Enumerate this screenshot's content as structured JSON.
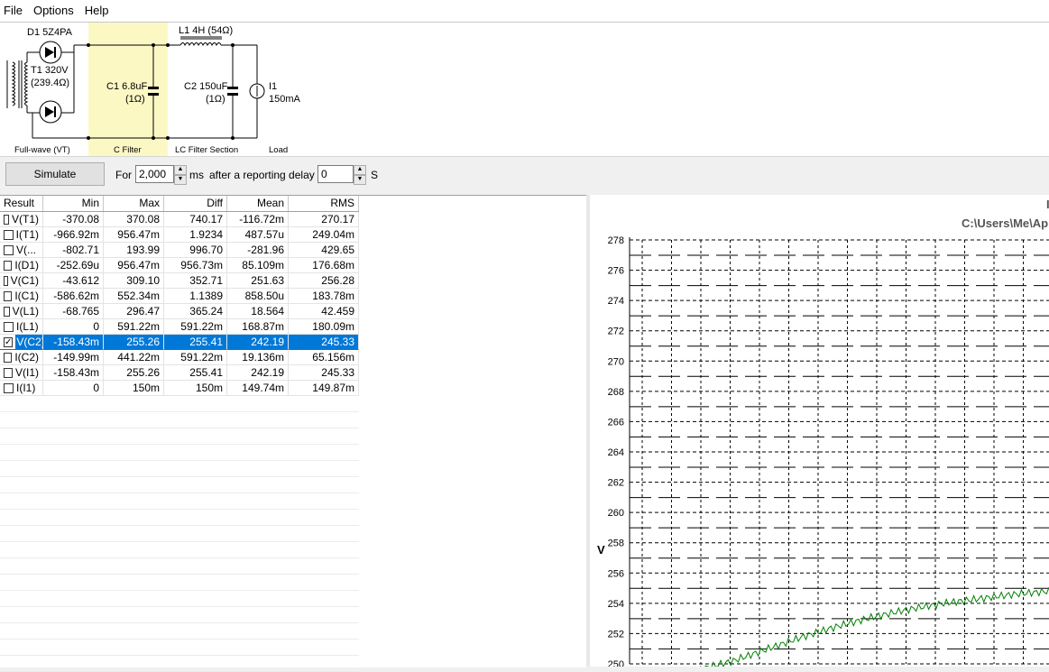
{
  "menu": [
    "File",
    "Options",
    "Help"
  ],
  "schematic": {
    "d1": "D1 5Z4PA",
    "t1a": "T1 320V",
    "t1b": "(239.4Ω)",
    "l1": "L1 4H (54Ω)",
    "c1a": "C1 6.8uF",
    "c1b": "(1Ω)",
    "c2a": "C2 150uF",
    "c2b": "(1Ω)",
    "i1a": "I1",
    "i1b": "150mA",
    "sec_fullwave": "Full-wave (VT)",
    "sec_cfilter": "C Filter",
    "sec_lc": "LC Filter Section",
    "sec_load": "Load"
  },
  "toolbar": {
    "simulate": "Simulate",
    "for_label": "For",
    "duration": "2,000",
    "ms_label": "ms",
    "after_label": "after a reporting delay of",
    "delay": "0",
    "s_label": "S"
  },
  "table": {
    "headers": [
      "Result",
      "Min",
      "Max",
      "Diff",
      "Mean",
      "RMS"
    ],
    "rows": [
      {
        "name": "V(T1)",
        "checked": false,
        "min": "-370.08",
        "max": "370.08",
        "diff": "740.17",
        "mean": "-116.72m",
        "rms": "270.17"
      },
      {
        "name": "I(T1)",
        "checked": false,
        "min": "-966.92m",
        "max": "956.47m",
        "diff": "1.9234",
        "mean": "487.57u",
        "rms": "249.04m"
      },
      {
        "name": "V(...",
        "checked": false,
        "min": "-802.71",
        "max": "193.99",
        "diff": "996.70",
        "mean": "-281.96",
        "rms": "429.65"
      },
      {
        "name": "I(D1)",
        "checked": false,
        "min": "-252.69u",
        "max": "956.47m",
        "diff": "956.73m",
        "mean": "85.109m",
        "rms": "176.68m"
      },
      {
        "name": "V(C1)",
        "checked": false,
        "min": "-43.612",
        "max": "309.10",
        "diff": "352.71",
        "mean": "251.63",
        "rms": "256.28"
      },
      {
        "name": "I(C1)",
        "checked": false,
        "min": "-586.62m",
        "max": "552.34m",
        "diff": "1.1389",
        "mean": "858.50u",
        "rms": "183.78m"
      },
      {
        "name": "V(L1)",
        "checked": false,
        "min": "-68.765",
        "max": "296.47",
        "diff": "365.24",
        "mean": "18.564",
        "rms": "42.459"
      },
      {
        "name": "I(L1)",
        "checked": false,
        "min": "0",
        "max": "591.22m",
        "diff": "591.22m",
        "mean": "168.87m",
        "rms": "180.09m"
      },
      {
        "name": "V(C2)",
        "checked": true,
        "min": "-158.43m",
        "max": "255.26",
        "diff": "255.41",
        "mean": "242.19",
        "rms": "245.33"
      },
      {
        "name": "I(C2)",
        "checked": false,
        "min": "-149.99m",
        "max": "441.22m",
        "diff": "591.22m",
        "mean": "19.136m",
        "rms": "65.156m"
      },
      {
        "name": "V(I1)",
        "checked": false,
        "min": "-158.43m",
        "max": "255.26",
        "diff": "255.41",
        "mean": "242.19",
        "rms": "245.33"
      },
      {
        "name": "I(I1)",
        "checked": false,
        "min": "0",
        "max": "150m",
        "diff": "150m",
        "mean": "149.74m",
        "rms": "149.87m"
      }
    ]
  },
  "chart": {
    "title_fragment": "I",
    "path_title": "C:\\Users\\Me\\App",
    "ylabel": "V"
  },
  "chart_data": {
    "type": "line",
    "ylabel": "V",
    "ylim": [
      250,
      278
    ],
    "yticks": [
      278,
      276,
      274,
      272,
      270,
      268,
      266,
      264,
      262,
      260,
      258,
      256,
      254,
      252,
      250
    ],
    "grid": true,
    "series": [
      {
        "color": "#008000",
        "y": [
          249.6,
          250.2,
          251.0,
          251.8,
          252.5,
          253.1,
          253.6,
          254.0,
          254.3,
          254.6,
          254.8
        ]
      }
    ]
  },
  "colors": {
    "highlight": "#fcf8c4",
    "selection": "#0078d7",
    "trace": "#008000"
  }
}
